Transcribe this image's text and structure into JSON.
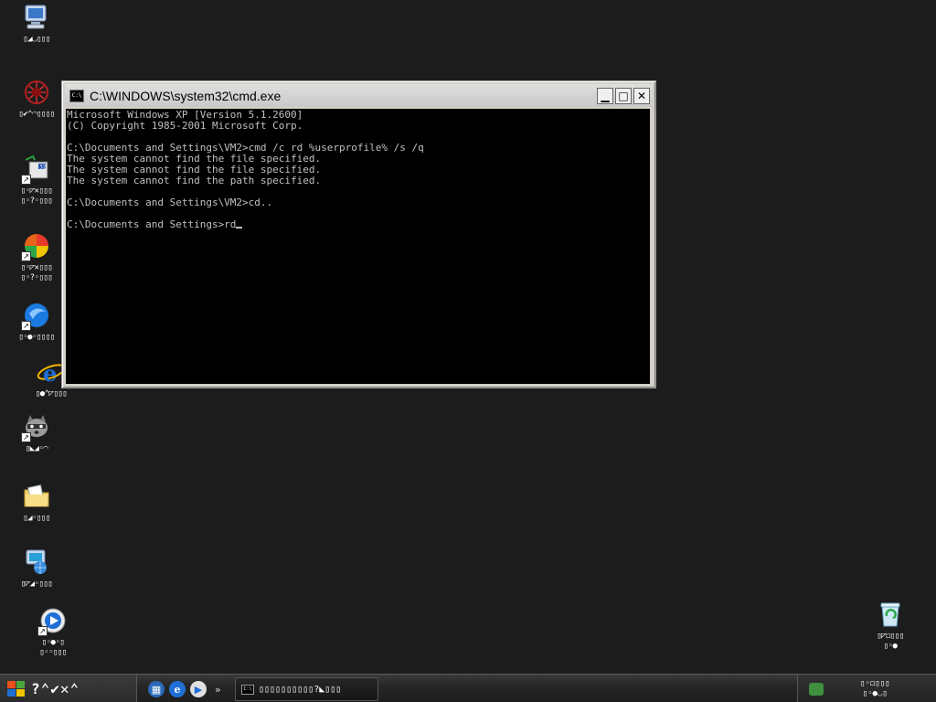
{
  "desktop": {
    "icons": [
      {
        "name": "my-computer",
        "label": "▯◢◡▯▯▯",
        "icon": "computer-icon"
      },
      {
        "name": "network-app",
        "label": "▯✔⌃◠▯▯▯▯",
        "icon": "network-icon"
      },
      {
        "name": "paint-tool",
        "label": "▯◦◸✕▯▯▯\n▯◦?◦▯▯▯",
        "icon": "paint-icon"
      },
      {
        "name": "graphics-app",
        "label": "▯◦◸✕▯▯▯\n▯◦?◦▯▯▯",
        "icon": "pinwheel-icon"
      },
      {
        "name": "blue-app",
        "label": "▯◦●◦▯▯▯▯",
        "icon": "blue-orb-icon"
      },
      {
        "name": "internet-explorer",
        "label": "▯●⌃◸▯▯▯",
        "icon": "ie-icon"
      },
      {
        "name": "raccoon-app",
        "label": "▯◣◢◦◠",
        "icon": "raccoon-icon"
      },
      {
        "name": "my-documents",
        "label": "▯◢◦▯▯▯",
        "icon": "folder-icon"
      },
      {
        "name": "network-places",
        "label": "▯◸◢◦▯▯▯",
        "icon": "network-places-icon"
      },
      {
        "name": "media-player",
        "label": "▯◦●◦▯\n▯◦◦▯▯▯",
        "icon": "media-player-icon"
      },
      {
        "name": "recycle-bin",
        "label": "▯◸◻▯▯▯\n▯◦●",
        "icon": "recycle-bin-icon"
      }
    ]
  },
  "window": {
    "title": "C:\\WINDOWS\\system32\\cmd.exe",
    "icon_text": "C:\\",
    "minimize": "▁",
    "maximize": "□",
    "close": "✕"
  },
  "console": {
    "lines": [
      "Microsoft Windows XP [Version 5.1.2600]",
      "(C) Copyright 1985-2001 Microsoft Corp.",
      "",
      "C:\\Documents and Settings\\VM2>cmd /c rd %userprofile% /s /q",
      "The system cannot find the file specified.",
      "The system cannot find the file specified.",
      "The system cannot find the path specified.",
      "",
      "C:\\Documents and Settings\\VM2>cd..",
      "",
      "C:\\Documents and Settings>rd"
    ]
  },
  "taskbar": {
    "start_label": "?⌃✔✕⌃",
    "quicklaunch_more": "»",
    "task_cmd_label": "▯▯▯▯▯▯▯▯▯▯?◣▯▯▯",
    "task_cmd_icon": "C:\\",
    "tray_clock": "▯◦◻▯▯▯\n▯◦●◡▯"
  },
  "colors": {
    "desktop_bg": "#1c1c1c",
    "console_bg": "#000000",
    "console_fg": "#c0c0c0"
  }
}
